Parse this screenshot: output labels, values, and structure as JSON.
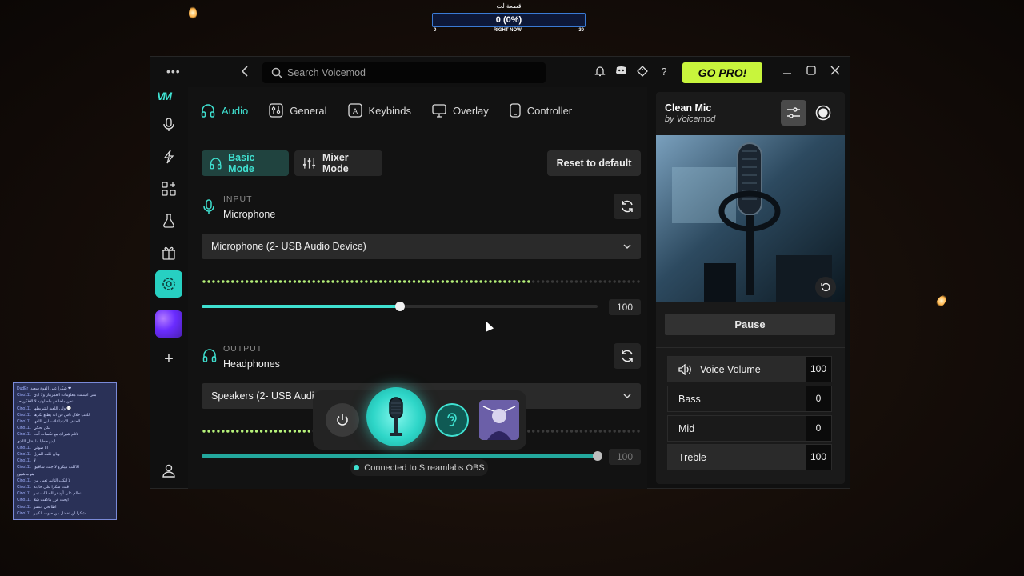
{
  "stream_overlay": {
    "title": "قطعة لت",
    "counter": "0 (0%)",
    "axis_min": "0",
    "axis_label": "RIGHT NOW",
    "axis_max": "30"
  },
  "window": {
    "menu_icon": "more-dots-icon",
    "search_placeholder": "Search Voicemod",
    "go_pro_label": "GO PRO!",
    "title_icons": [
      "bell-icon",
      "discord-icon",
      "tag-icon",
      "help-icon"
    ],
    "help_glyph": "?"
  },
  "sidebar": {
    "logo": "VM",
    "items": [
      {
        "name": "voicebox-icon"
      },
      {
        "name": "effects-icon"
      },
      {
        "name": "apps-icon"
      },
      {
        "name": "lab-icon"
      },
      {
        "name": "store-icon"
      },
      {
        "name": "settings-icon",
        "active": true
      },
      {
        "name": "avatar-icon"
      },
      {
        "name": "add-icon"
      }
    ],
    "add_glyph": "+"
  },
  "settings": {
    "tabs": [
      {
        "label": "Audio",
        "icon": "headphones-icon",
        "active": true
      },
      {
        "label": "General",
        "icon": "sliders-icon"
      },
      {
        "label": "Keybinds",
        "icon": "key-icon"
      },
      {
        "label": "Overlay",
        "icon": "monitor-icon"
      },
      {
        "label": "Controller",
        "icon": "controller-icon"
      }
    ],
    "basic_mode_label": "Basic Mode",
    "mixer_mode_label": "Mixer Mode",
    "reset_label": "Reset to default",
    "input": {
      "section_label": "INPUT",
      "type": "Microphone",
      "device": "Microphone (2- USB Audio Device)",
      "level": 0.74,
      "volume_fraction": 0.5,
      "volume_value": "100"
    },
    "output": {
      "section_label": "OUTPUT",
      "type": "Headphones",
      "device": "Speakers (2- USB Audio Device)",
      "device_visible": "Speakers (2- USB Audio",
      "volume_fraction": 1.0,
      "volume_value": "100"
    }
  },
  "voice_panel": {
    "voice_name": "Clean Mic",
    "author": "by Voicemod",
    "pause_label": "Pause",
    "params": [
      {
        "label": "Voice Volume",
        "value": "100",
        "icon": "speaker-icon"
      },
      {
        "label": "Bass",
        "value": "0"
      },
      {
        "label": "Mid",
        "value": "0"
      },
      {
        "label": "Treble",
        "value": "100"
      }
    ]
  },
  "floating_controls": {
    "connected_text": "Connected to Streamlabs OBS"
  },
  "chat_lines": [
    {
      "user": "DudEr",
      "text": "شكرا على القوة سعيد ❤"
    },
    {
      "user": "Cino111",
      "text": "متى اشتقت معلومات العمرهار ولا اذي"
    },
    {
      "user": "",
      "text": "نحن ماخالفو ماطلونيد لا الافكن حد"
    },
    {
      "user": "Cino111",
      "text": "ولي اللعبة لشريطها 💬"
    },
    {
      "user": "Cino111",
      "text": "اللعب حلال ناس فن انه يطلع بكرها"
    },
    {
      "user": "Cino111",
      "text": "العنيف الادنداعلات لبي اللغها"
    },
    {
      "user": "Cino111",
      "text": "لكن بحكي"
    },
    {
      "user": "Cino111",
      "text": "لاتام شيراك مع نكسات آنت"
    },
    {
      "user": "",
      "text": "ايدو حطبا ما بقتل اللذي"
    },
    {
      "user": "Cino111",
      "text": "انا صوتي"
    },
    {
      "user": "Cino111",
      "text": "وبان قلب الفرق"
    },
    {
      "user": "Cino111",
      "text": "لا"
    },
    {
      "user": "Cino111",
      "text": "الاكلب ميكرو لا جبت شاقبق"
    },
    {
      "user": "",
      "text": "هو ماشيوو"
    },
    {
      "user": "Cino111",
      "text": "لا انكب التاني تعيي من"
    },
    {
      "user": "Cino111",
      "text": "قلت شكرا على حادثة"
    },
    {
      "user": "Cino111",
      "text": "نطام على أودعر الصلاات تمر"
    },
    {
      "user": "Cino111",
      "text": "ايحت فرز ماكفت شلا"
    },
    {
      "user": "Cino111",
      "text": "اطالحي انتضر"
    },
    {
      "user": "Cino111",
      "text": "شكرا لن تفضل من صوت الكبير"
    }
  ]
}
